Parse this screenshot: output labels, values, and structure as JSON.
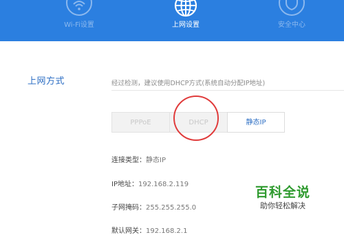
{
  "header": {
    "nav": [
      {
        "label": "Wi-Fi设置",
        "icon": "wifi-icon",
        "active": false
      },
      {
        "label": "上网设置",
        "icon": "globe-icon",
        "active": true
      },
      {
        "label": "安全中心",
        "icon": "shield-icon",
        "active": false
      }
    ],
    "background_color": "#2b7fe0"
  },
  "section": {
    "title": "上网方式",
    "hint": "经过检测，建议使用DHCP方式(系统自动分配IP地址)"
  },
  "tabs": [
    {
      "label": "PPPoE",
      "selected": false
    },
    {
      "label": "DHCP",
      "selected": false
    },
    {
      "label": "静态IP",
      "selected": true
    }
  ],
  "info": [
    {
      "label": "连接类型：",
      "value": "静态IP"
    },
    {
      "label": "IP地址：",
      "value": "192.168.2.119"
    },
    {
      "label": "子网掩码：",
      "value": "255.255.255.0"
    },
    {
      "label": "默认网关：",
      "value": "192.168.2.1"
    }
  ],
  "watermark": {
    "title": "百科全说",
    "subtitle": "助你轻松解决"
  },
  "colors": {
    "accent": "#2e6fc4",
    "highlight_circle": "#e03b3b",
    "watermark_green": "#2e9a2e"
  }
}
